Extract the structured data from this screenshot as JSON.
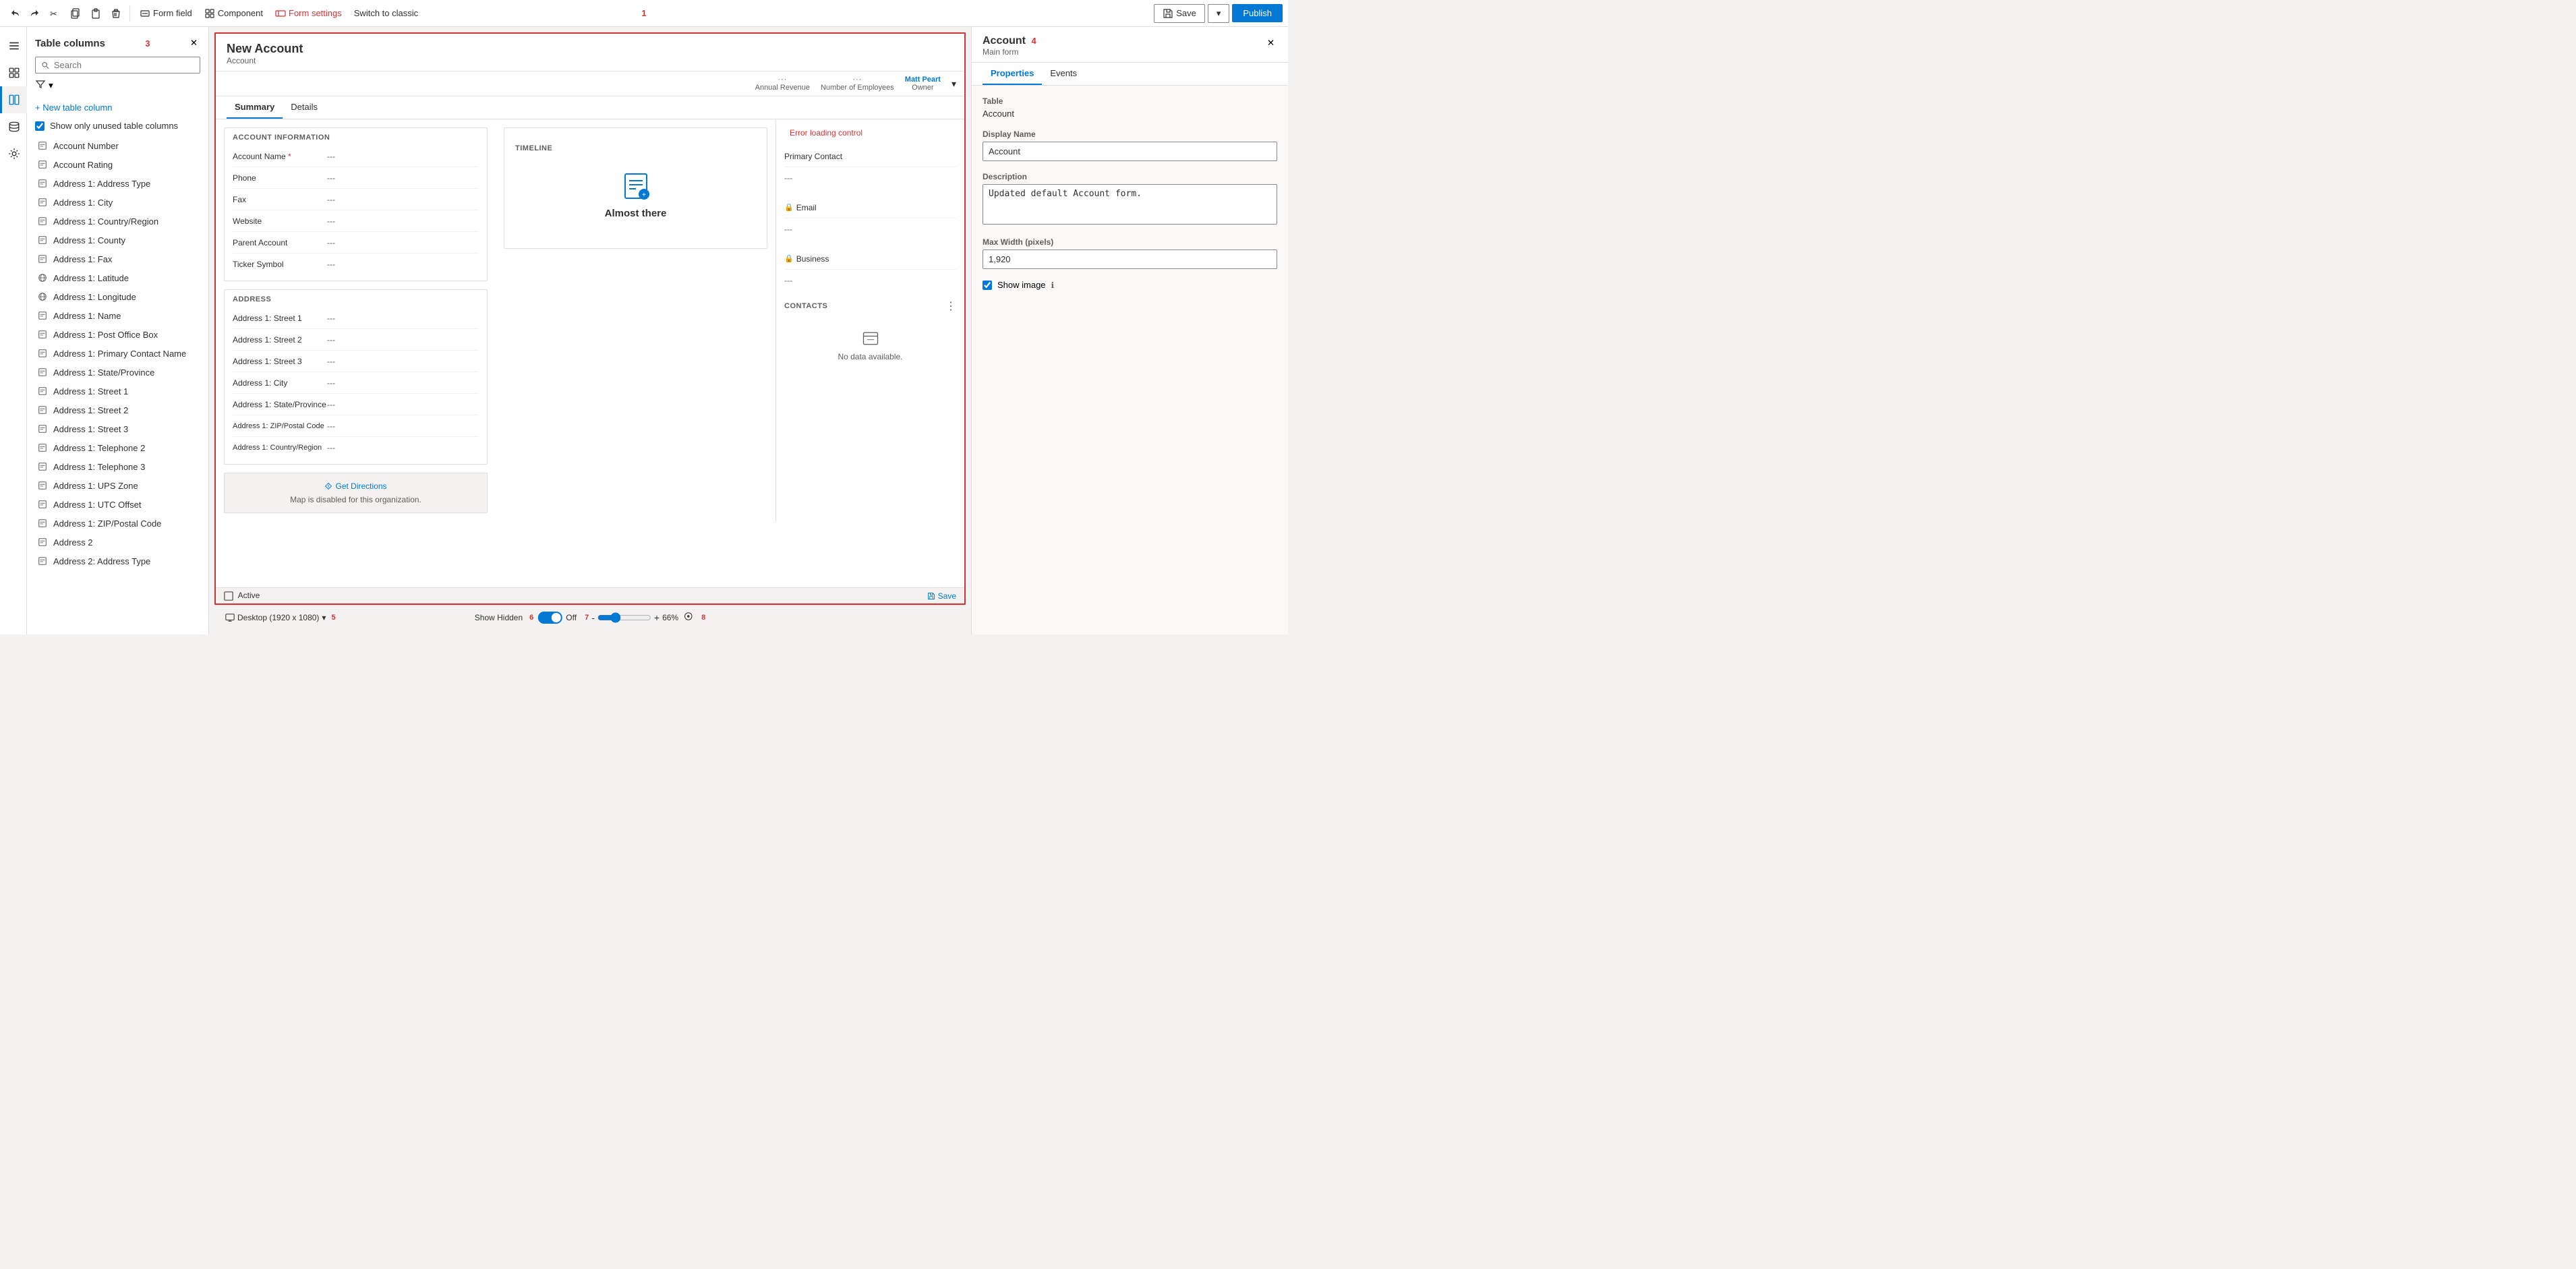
{
  "toolbar": {
    "undo_label": "Undo",
    "redo_label": "Redo",
    "cut_label": "Cut",
    "copy_label": "Copy",
    "delete_label": "Delete",
    "form_field_label": "Form field",
    "component_label": "Component",
    "form_settings_label": "Form settings",
    "switch_classic_label": "Switch to classic",
    "save_label": "Save",
    "publish_label": "Publish",
    "red_label": "1"
  },
  "left_panel": {
    "title": "Table columns",
    "search_placeholder": "Search",
    "new_column_label": "+ New table column",
    "show_unused_label": "Show only unused table columns",
    "red_label": "3",
    "columns": [
      {
        "icon": "text",
        "label": "Account Number"
      },
      {
        "icon": "text",
        "label": "Account Rating"
      },
      {
        "icon": "text",
        "label": "Address 1: Address Type"
      },
      {
        "icon": "text",
        "label": "Address 1: City"
      },
      {
        "icon": "text",
        "label": "Address 1: Country/Region"
      },
      {
        "icon": "text",
        "label": "Address 1: County"
      },
      {
        "icon": "text",
        "label": "Address 1: Fax"
      },
      {
        "icon": "globe",
        "label": "Address 1: Latitude"
      },
      {
        "icon": "globe",
        "label": "Address 1: Longitude"
      },
      {
        "icon": "text",
        "label": "Address 1: Name"
      },
      {
        "icon": "text",
        "label": "Address 1: Post Office Box"
      },
      {
        "icon": "text",
        "label": "Address 1: Primary Contact Name"
      },
      {
        "icon": "text",
        "label": "Address 1: State/Province"
      },
      {
        "icon": "text",
        "label": "Address 1: Street 1"
      },
      {
        "icon": "text",
        "label": "Address 1: Street 2"
      },
      {
        "icon": "text",
        "label": "Address 1: Street 3"
      },
      {
        "icon": "text",
        "label": "Address 1: Telephone 2"
      },
      {
        "icon": "text",
        "label": "Address 1: Telephone 3"
      },
      {
        "icon": "text",
        "label": "Address 1: UPS Zone"
      },
      {
        "icon": "text",
        "label": "Address 1: UTC Offset"
      },
      {
        "icon": "text",
        "label": "Address 1: ZIP/Postal Code"
      },
      {
        "icon": "text",
        "label": "Address 2"
      },
      {
        "icon": "text",
        "label": "Address 2: Address Type"
      }
    ]
  },
  "form_canvas": {
    "title": "New Account",
    "subtitle": "Account",
    "tabs": [
      "Summary",
      "Details"
    ],
    "active_tab": "Summary",
    "header_fields": [
      {
        "label": "Annual Revenue",
        "dots": "···"
      },
      {
        "label": "Number of Employees",
        "dots": "···"
      },
      {
        "label": "Owner",
        "value": "Matt Peart",
        "is_link": true
      }
    ],
    "account_info_section": {
      "title": "ACCOUNT INFORMATION",
      "fields": [
        {
          "label": "Account Name",
          "value": "---",
          "required": true
        },
        {
          "label": "Phone",
          "value": "---"
        },
        {
          "label": "Fax",
          "value": "---"
        },
        {
          "label": "Website",
          "value": "---"
        },
        {
          "label": "Parent Account",
          "value": "---"
        },
        {
          "label": "Ticker Symbol",
          "value": "---"
        }
      ]
    },
    "address_section": {
      "title": "ADDRESS",
      "fields": [
        {
          "label": "Address 1: Street 1",
          "value": "---"
        },
        {
          "label": "Address 1: Street 2",
          "value": "---"
        },
        {
          "label": "Address 1: Street 3",
          "value": "---"
        },
        {
          "label": "Address 1: City",
          "value": "---"
        },
        {
          "label": "Address 1: State/Province",
          "value": "---"
        },
        {
          "label": "Address 1: ZIP/Postal Code",
          "value": "---"
        },
        {
          "label": "Address 1: Country/Region",
          "value": "---"
        }
      ]
    },
    "map_section": {
      "get_directions_label": "Get Directions",
      "map_disabled_text": "Map is disabled for this organization."
    },
    "timeline_section": {
      "title": "Timeline",
      "almost_there_text": "Almost there"
    },
    "right_col": {
      "error_loading": "Error loading control",
      "primary_contact_label": "Primary Contact",
      "email_label": "Email",
      "business_label": "Business",
      "contacts_title": "CONTACTS",
      "no_data_text": "No data available."
    },
    "footer": {
      "status": "Active",
      "save_label": "Save"
    }
  },
  "right_panel": {
    "title": "Account",
    "subtitle": "Main form",
    "tabs": [
      "Properties",
      "Events"
    ],
    "active_tab": "Properties",
    "red_label": "4",
    "table_label": "Table",
    "table_value": "Account",
    "display_name_label": "Display Name",
    "display_name_value": "Account",
    "description_label": "Description",
    "description_value": "Updated default Account form.",
    "max_width_label": "Max Width (pixels)",
    "max_width_value": "1,920",
    "show_image_label": "Show image",
    "info_icon": "ℹ"
  },
  "bottom_bar": {
    "desktop_label": "Desktop (1920 x 1080)",
    "show_hidden_label": "Show Hidden",
    "toggle_state": "Off",
    "zoom_minus": "-",
    "zoom_plus": "+",
    "zoom_value": "66%",
    "red_label_5": "5",
    "red_label_6": "6",
    "red_label_7": "7",
    "red_label_8": "8"
  },
  "colors": {
    "accent": "#0078d4",
    "red": "#d13438",
    "border": "#e1dfdd",
    "text_primary": "#323130",
    "text_secondary": "#605e5c"
  }
}
